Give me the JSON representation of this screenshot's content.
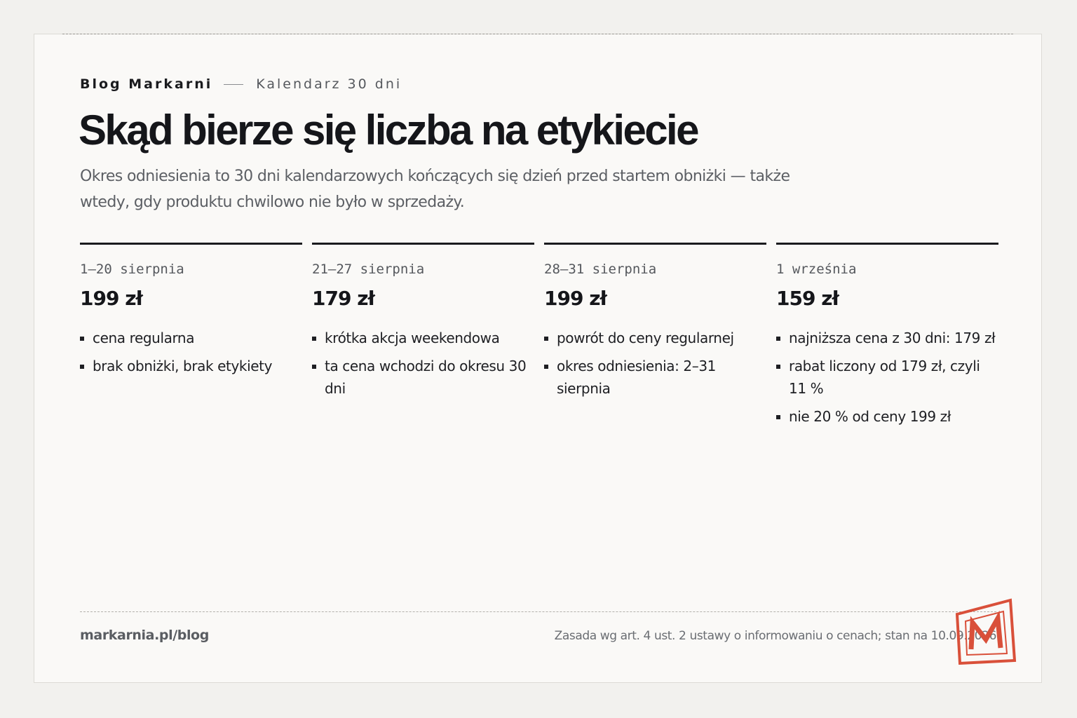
{
  "header": {
    "brand": "Blog Markarni",
    "section": "Kalendarz 30 dni"
  },
  "title": "Skąd bierze się liczba na etykiecie",
  "lead": "Okres odniesienia to 30 dni kalendarzowych kończących się dzień przed startem obniżki — także wtedy, gdy produktu chwilowo nie było w sprzedaży.",
  "periods": [
    {
      "date": "1–20 sierpnia",
      "price": "199 zł",
      "notes": [
        "cena regularna",
        "brak obniżki, brak etykiety"
      ]
    },
    {
      "date": "21–27 sierpnia",
      "price": "179 zł",
      "notes": [
        "krótka akcja weekendowa",
        "ta cena wchodzi do okresu 30 dni"
      ]
    },
    {
      "date": "28–31 sierpnia",
      "price": "199 zł",
      "notes": [
        "powrót do ceny regularnej",
        "okres odniesienia: 2–31 sierpnia"
      ]
    },
    {
      "date": "1 września",
      "price": "159 zł",
      "notes": [
        "najniższa cena z 30 dni: 179 zł",
        "rabat liczony od 179 zł, czyli 11 %",
        "nie 20 % od ceny 199 zł"
      ]
    }
  ],
  "footer": {
    "link": "markarnia.pl/blog",
    "note": "Zasada wg art. 4 ust. 2 ustawy o informowaniu o cenach; stan na 10.09.2026"
  },
  "colors": {
    "accent": "#d9503a",
    "ink": "#15161a",
    "muted": "#5c5f64",
    "card": "#faf9f7",
    "background": "#f2f1ee"
  },
  "logo": {
    "icon": "markarnia-m-logo",
    "letter": "M"
  }
}
